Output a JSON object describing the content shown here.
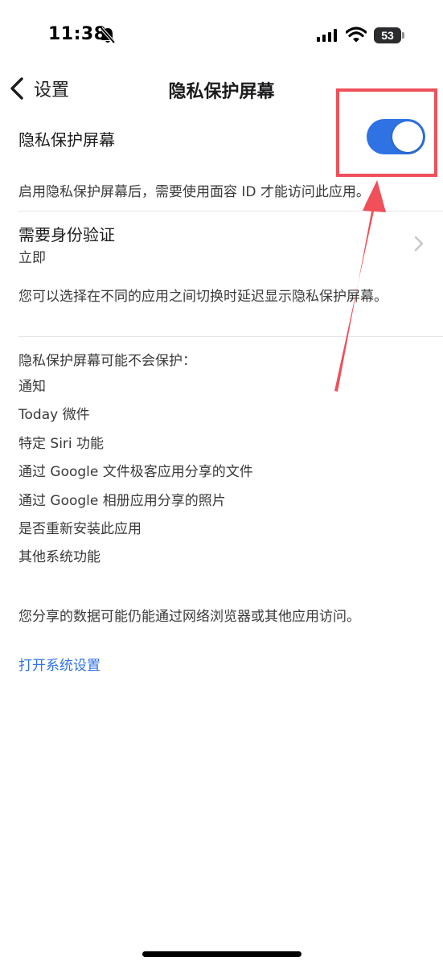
{
  "status_bar": {
    "time": "11:38",
    "battery": "53",
    "icons": [
      "bell-slash-icon",
      "signal-icon",
      "wifi-icon",
      "battery-icon"
    ]
  },
  "nav": {
    "back_label": "设置",
    "title": "隐私保护屏幕"
  },
  "privacy_toggle": {
    "label": "隐私保护屏幕",
    "enabled": true,
    "accent_color": "#2f72e4"
  },
  "toggle_description": "启用隐私保护屏幕后，需要使用面容 ID 才能访问此应用。",
  "auth": {
    "title": "需要身份验证",
    "value": "立即"
  },
  "delay_description": "您可以选择在不同的应用之间切换时延迟显示隐私保护屏幕。",
  "not_protected": {
    "heading": "隐私保护屏幕可能不会保护：",
    "items": [
      "通知",
      "Today 微件",
      "特定 Siri 功能",
      "通过 Google 文件极客应用分享的文件",
      "通过 Google 相册应用分享的照片",
      "是否重新安装此应用",
      "其他系统功能"
    ]
  },
  "share_description": "您分享的数据可能仍能通过网络浏览器或其他应用访问。",
  "open_settings_link": "打开系统设置",
  "annotation": {
    "color": "#f0505a"
  }
}
